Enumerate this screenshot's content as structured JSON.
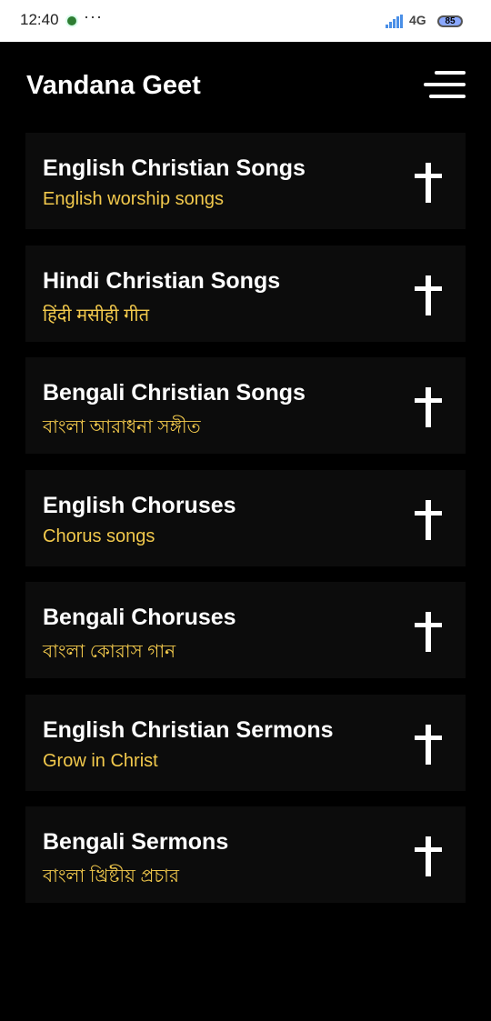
{
  "status_bar": {
    "time": "12:40",
    "more": "···",
    "network": "4G",
    "battery": "85"
  },
  "header": {
    "title": "Vandana Geet"
  },
  "items": [
    {
      "title": "English Christian Songs",
      "subtitle": "English worship songs"
    },
    {
      "title": "Hindi Christian Songs",
      "subtitle": "हिंदी मसीही गीत"
    },
    {
      "title": "Bengali Christian Songs",
      "subtitle": "বাংলা আরাধনা সঙ্গীত"
    },
    {
      "title": "English Choruses",
      "subtitle": "Chorus songs"
    },
    {
      "title": "Bengali Choruses",
      "subtitle": "বাংলা কোরাস গান"
    },
    {
      "title": "English Christian Sermons",
      "subtitle": "Grow in Christ"
    },
    {
      "title": "Bengali Sermons",
      "subtitle": "বাংলা খ্রিষ্টীয় প্রচার"
    }
  ],
  "colors": {
    "background": "#000000",
    "card": "#0c0c0c",
    "title": "#ffffff",
    "subtitle": "#f2c94c"
  },
  "icons": {
    "item_icon": "cross-icon",
    "menu_icon": "hamburger-menu-icon"
  }
}
